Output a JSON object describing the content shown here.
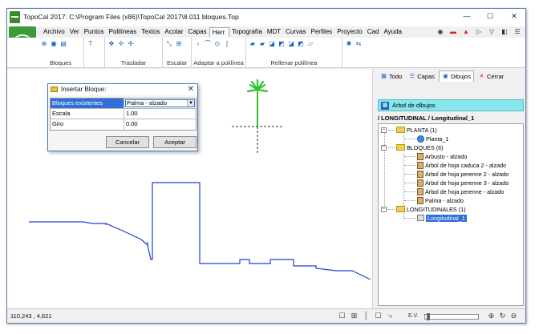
{
  "titlebar": {
    "title": "TopoCal 2017: C:\\Program Files (x86)\\TopoCal 2017\\8.011 bloques.Top",
    "minimize": "—",
    "maximize": "☐",
    "close": "✕"
  },
  "menu": {
    "items": [
      "Archivo",
      "Ver",
      "Puntos",
      "Polilíneas",
      "Textos",
      "Acotar",
      "Capas",
      "Herr.",
      "Topografía",
      "MDT",
      "Curvas",
      "Perfiles",
      "Proyecto",
      "Cad",
      "Ayuda"
    ],
    "active_index": 7
  },
  "ribbon": {
    "groups": [
      {
        "label": "Bloques"
      },
      {
        "label": ""
      },
      {
        "label": "Trasladar"
      },
      {
        "label": "Escalar"
      },
      {
        "label": "Adaptar a polilínea"
      },
      {
        "label": "Rellenar polilínea"
      },
      {
        "label": ""
      }
    ]
  },
  "dialog": {
    "title": "Insertar Bloque:",
    "close": "✕",
    "rows": [
      {
        "key": "Bloques existentes",
        "value": "Palma - alzado"
      },
      {
        "key": "Escala",
        "value": "1.00"
      },
      {
        "key": "Giro",
        "value": "0.00"
      }
    ],
    "cancel_label": "Cancelar",
    "accept_label": "Aceptar"
  },
  "panel": {
    "tabs": [
      {
        "label": "Todo",
        "icon": "grid-icon"
      },
      {
        "label": "Capas",
        "icon": "layers-icon"
      },
      {
        "label": "Dibujos",
        "icon": "drawings-icon"
      },
      {
        "label": "Cerrar",
        "icon": "close-x-icon"
      }
    ],
    "active_tab": 2,
    "header": "Árbol de dibujos",
    "breadcrumb": "/ LONGITUDINAL / Longitudinal_1",
    "tree": {
      "planta": {
        "label": "PLANTA (1)",
        "children": [
          "Planta_1"
        ]
      },
      "bloques": {
        "label": "BLOQUES (6)",
        "children": [
          "Arbusto - alzado",
          "Árbol de hoja caduca 2 - alzado",
          "Árbol de hoja perenne 2 - alzado",
          "Árbol de hoja perenne 3 - alzado",
          "Árbol de hoja perenne - alzado",
          "Palma - alzado"
        ]
      },
      "longitudinales": {
        "label": "LONGITUDINALES (1)",
        "children": [
          "Longitudinal_1"
        ]
      }
    }
  },
  "statusbar": {
    "coords": "110,243 , 4,621",
    "ev_label": "E.V."
  },
  "colors": {
    "profile_line": "#1f3fd6",
    "palm_green": "#2fc42f",
    "selection": "#2f6fd6",
    "panel_header": "#86e6ee"
  }
}
